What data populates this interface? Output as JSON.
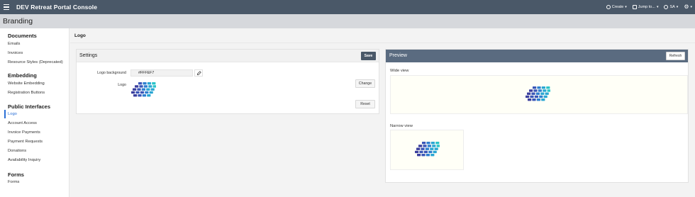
{
  "app": {
    "title": "DEV Retreat Portal Console",
    "actions": {
      "create": "Create",
      "jump": "Jump to...",
      "user": "SA"
    }
  },
  "page": {
    "title": "Branding"
  },
  "sidebar": {
    "sections": [
      {
        "heading": "Documents",
        "items": [
          "Emails",
          "Invoices",
          "Resource Styles (Deprecated)"
        ]
      },
      {
        "heading": "Embedding",
        "items": [
          "Website Embedding",
          "Registration Buttons"
        ]
      },
      {
        "heading": "Public Interfaces",
        "items": [
          "Logo",
          "Account Access",
          "Invoice Payments",
          "Payment Requests",
          "Donations",
          "Availability Inquiry"
        ]
      },
      {
        "heading": "Forms",
        "items": [
          "Forms"
        ]
      }
    ],
    "active_item": "Logo"
  },
  "main": {
    "title": "Logo",
    "settings": {
      "title": "Settings",
      "save_label": "Save",
      "logo_background_label": "Logo background",
      "logo_background_value": "#FFFEF7",
      "logo_label": "Logo",
      "change_label": "Change",
      "reset_label": "Reset"
    },
    "preview": {
      "title": "Preview",
      "refresh_label": "Refresh",
      "wide_label": "Wide view",
      "narrow_label": "Narrow view"
    }
  },
  "colors": {
    "topbar": "#4a5868",
    "preview_header": "#5a6b80",
    "accent": "#2a6fd6",
    "preview_bg": "#fffff7",
    "logo_colors": [
      "#3b3f9e",
      "#3a56b8",
      "#2f7fd0",
      "#2aa6d3",
      "#2bc3c9"
    ]
  },
  "icons": {
    "menu": "hamburger-icon",
    "create": "plus-circle-icon",
    "jump": "window-icon",
    "user": "globe-icon",
    "settings": "gear-icon",
    "color_picker": "eyedropper-icon"
  }
}
